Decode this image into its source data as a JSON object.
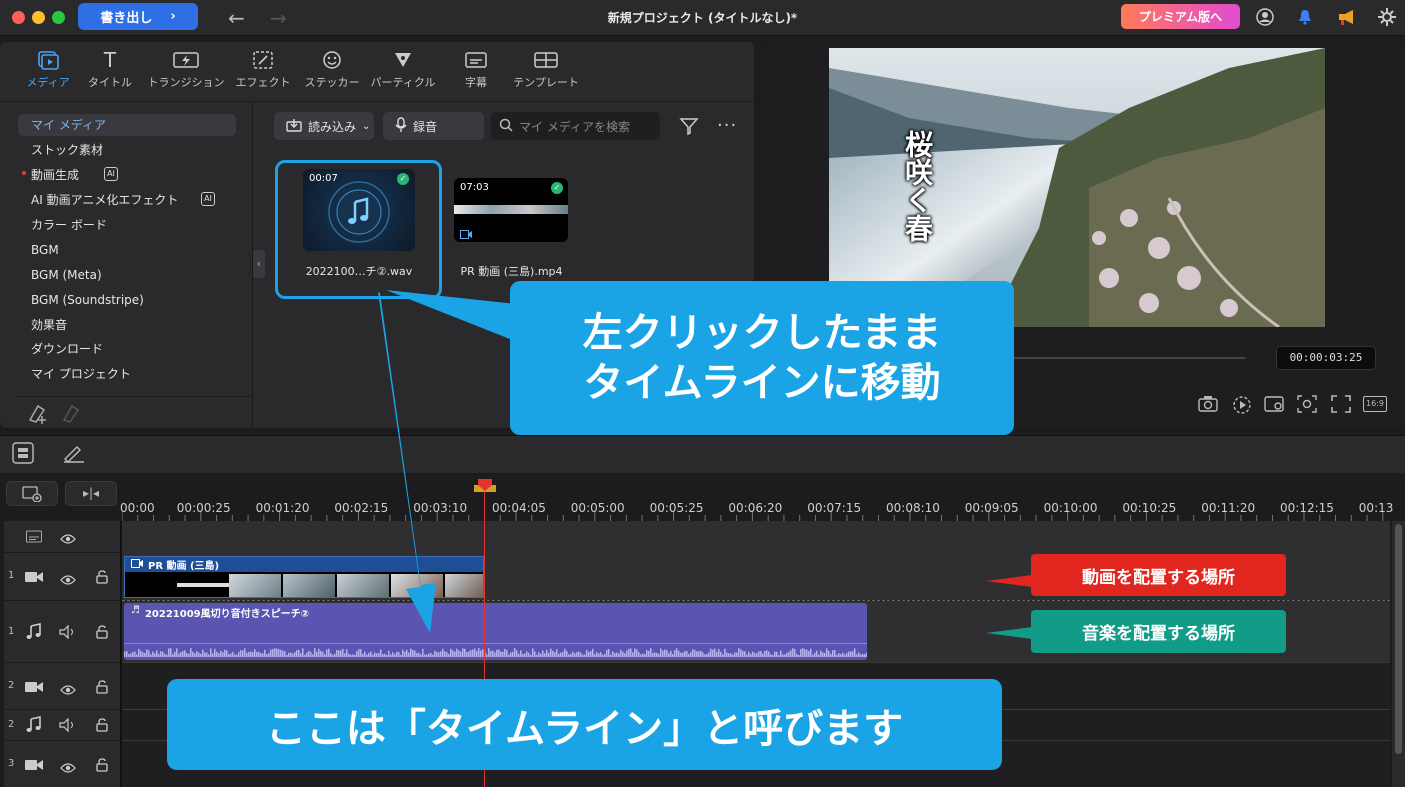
{
  "titlebar": {
    "export_label": "書き出し",
    "title": "新規プロジェクト (タイトルなし)*",
    "premium_label": "プレミアム版へ"
  },
  "tabs": [
    {
      "label": "メディア",
      "icon": "media-icon",
      "active": true
    },
    {
      "label": "タイトル",
      "icon": "title-icon"
    },
    {
      "label": "トランジション",
      "icon": "transition-icon"
    },
    {
      "label": "エフェクト",
      "icon": "effect-icon"
    },
    {
      "label": "ステッカー",
      "icon": "sticker-icon"
    },
    {
      "label": "パーティクル",
      "icon": "particle-icon"
    },
    {
      "label": "字幕",
      "icon": "subtitle-icon"
    },
    {
      "label": "テンプレート",
      "icon": "template-icon"
    }
  ],
  "sidebar": {
    "items": [
      {
        "label": "マイ メディア",
        "active": true
      },
      {
        "label": "ストック素材"
      },
      {
        "label": "動画生成",
        "badge": "AI"
      },
      {
        "label": "AI 動画アニメ化エフェクト",
        "badge": "AI"
      },
      {
        "label": "カラー ボード"
      },
      {
        "label": "BGM"
      },
      {
        "label": "BGM (Meta)"
      },
      {
        "label": "BGM (Soundstripe)"
      },
      {
        "label": "効果音"
      },
      {
        "label": "ダウンロード"
      },
      {
        "label": "マイ プロジェクト"
      }
    ]
  },
  "media_toolbar": {
    "import_label": "読み込み",
    "record_label": "録音",
    "search_placeholder": "マイ メディアを検索"
  },
  "media": [
    {
      "duration": "00:07",
      "name": "2022100…チ②.wav",
      "type": "audio"
    },
    {
      "duration": "07:03",
      "name": "PR 動画 (三島).mp4",
      "type": "video"
    }
  ],
  "preview": {
    "overlay_text": "桜咲く春",
    "timecode": "00:00:03:25",
    "aspect_label": "16:9"
  },
  "timeline": {
    "ruler_ticks": [
      "00:00",
      "00:00:25",
      "00:01:20",
      "00:02:15",
      "00:03:10",
      "00:04:05",
      "00:05:00",
      "00:05:25",
      "00:06:20",
      "00:07:15",
      "00:08:10",
      "00:09:05",
      "00:10:00",
      "00:10:25",
      "00:11:20",
      "00:12:15",
      "00:13"
    ],
    "video_clip_label": "PR 動画 (三島)",
    "audio_clip_label": "20221009風切り音付きスピーチ②",
    "track_numbers": [
      "1",
      "1",
      "2",
      "2",
      "3"
    ]
  },
  "annotations": {
    "drag_callout_line1": "左クリックしたまま",
    "drag_callout_line2": "タイムラインに移動",
    "video_tag": "動画を配置する場所",
    "audio_tag": "音楽を配置する場所",
    "timeline_callout": "ここは「タイムライン」と呼びます"
  },
  "colors": {
    "accent": "#2f6fe6",
    "callout": "#1aa4e6",
    "video_tag": "#e0261f",
    "audio_tag": "#119c88",
    "audio_clip": "#5a55b0",
    "playhead": "#e2332d"
  }
}
